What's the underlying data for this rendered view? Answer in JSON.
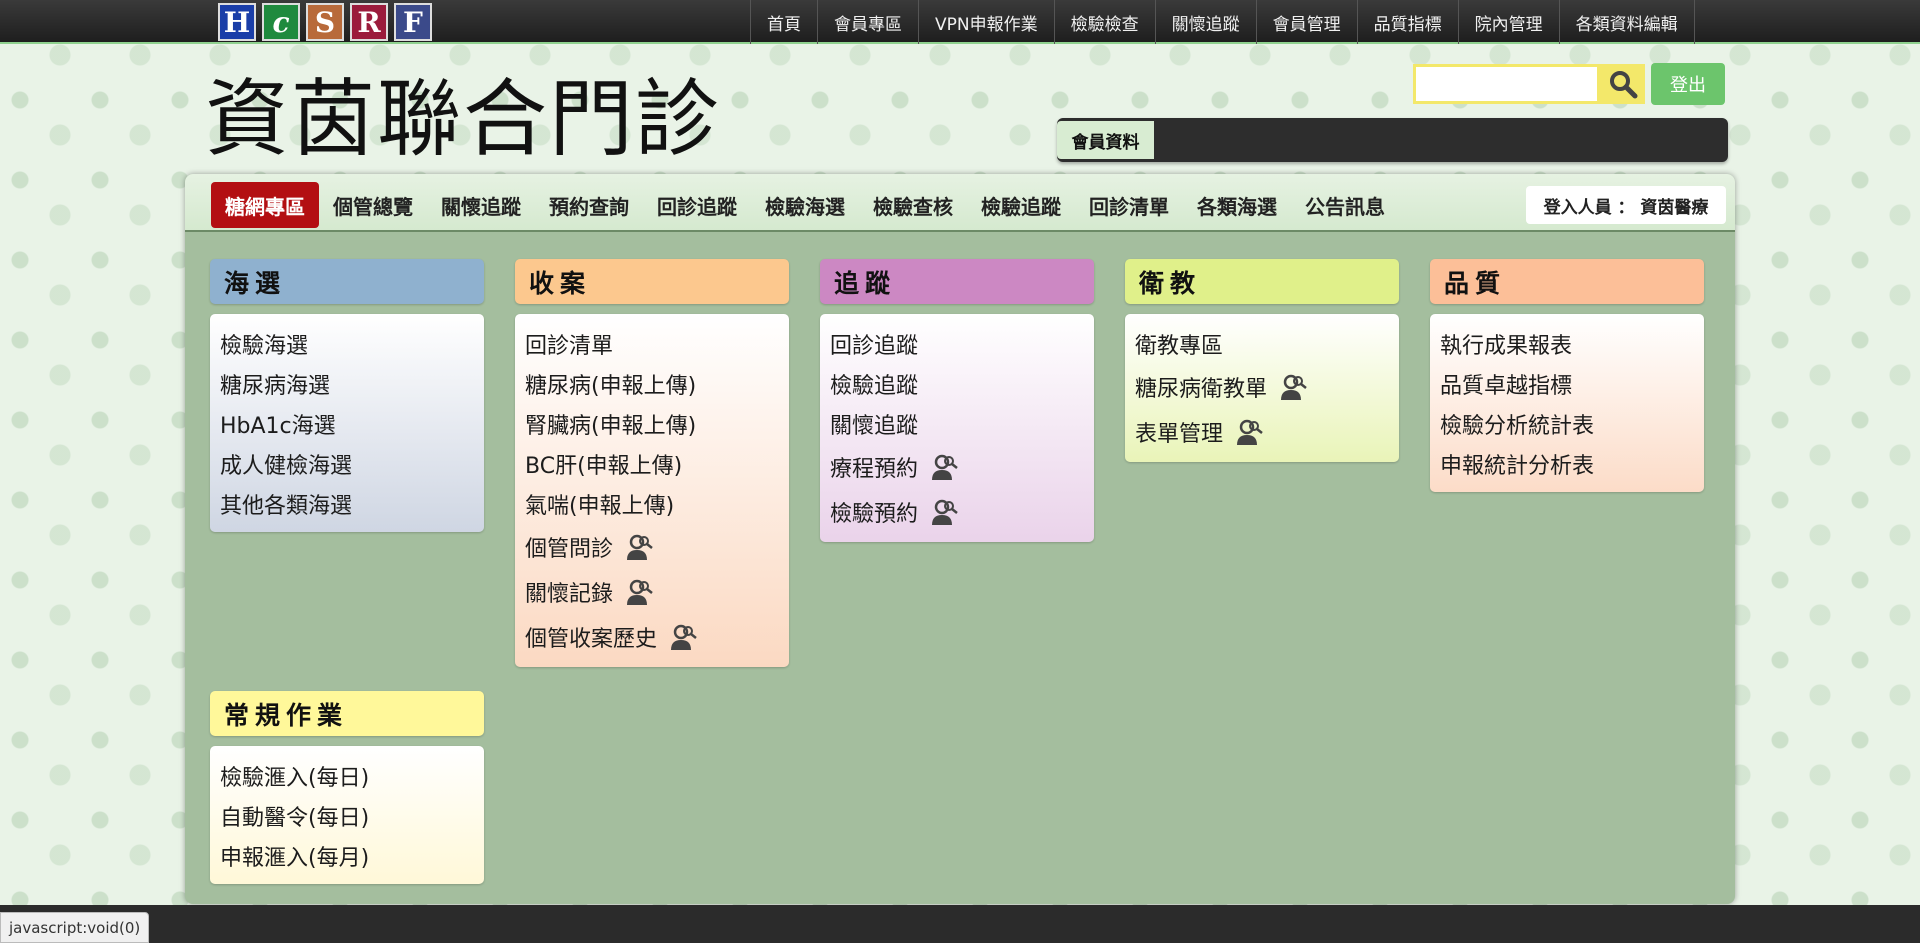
{
  "brand": {
    "letters": [
      "H",
      "c",
      "S",
      "R",
      "F"
    ]
  },
  "topnav": [
    "首頁",
    "會員專區",
    "VPN申報作業",
    "檢驗檢查",
    "關懷追蹤",
    "會員管理",
    "品質指標",
    "院內管理",
    "各類資料編輯"
  ],
  "header": {
    "site_title": "資茵聯合門診",
    "search_value": "",
    "logout_label": "登出",
    "member_label": "會員資料"
  },
  "subnav": {
    "tabs": [
      "糖網專區",
      "個管總覽",
      "關懷追蹤",
      "預約查詢",
      "回診追蹤",
      "檢驗海選",
      "檢驗查核",
      "檢驗追蹤",
      "回診清單",
      "各類海選",
      "公告訊息"
    ],
    "active_index": 0,
    "login_info": "登入人員 ： 資茵醫療"
  },
  "cards": {
    "screening": {
      "title": "海選",
      "items": [
        "檢驗海選",
        "糖尿病海選",
        "HbA1c海選",
        "成人健檢海選",
        "其他各類海選"
      ]
    },
    "enroll": {
      "title": "收案",
      "items": [
        "回診清單",
        "糖尿病(申報上傳)",
        "腎臟病(申報上傳)",
        "BC肝(申報上傳)",
        "氣喘(申報上傳)",
        "個管問診",
        "關懷記錄",
        "個管收案歷史"
      ]
    },
    "tracking": {
      "title": "追蹤",
      "items": [
        "回診追蹤",
        "檢驗追蹤",
        "關懷追蹤",
        "療程預約",
        "檢驗預約"
      ]
    },
    "education": {
      "title": "衛教",
      "items": [
        "衛教專區",
        "糖尿病衛教單",
        "表單管理"
      ]
    },
    "quality": {
      "title": "品質",
      "items": [
        "執行成果報表",
        "品質卓越指標",
        "檢驗分析統計表",
        "申報統計分析表"
      ]
    },
    "routine": {
      "title": "常規作業",
      "items": [
        "檢驗滙入(每日)",
        "自動醫令(每日)",
        "申報滙入(每月)"
      ]
    }
  },
  "status_bar": "javascript:void(0)",
  "colors": {
    "active_tab": "#b30f12",
    "logout": "#6cc56c",
    "search": "#f3e86a"
  },
  "icons": {
    "search": "magnifier-icon",
    "user_search": "user-search-icon"
  }
}
